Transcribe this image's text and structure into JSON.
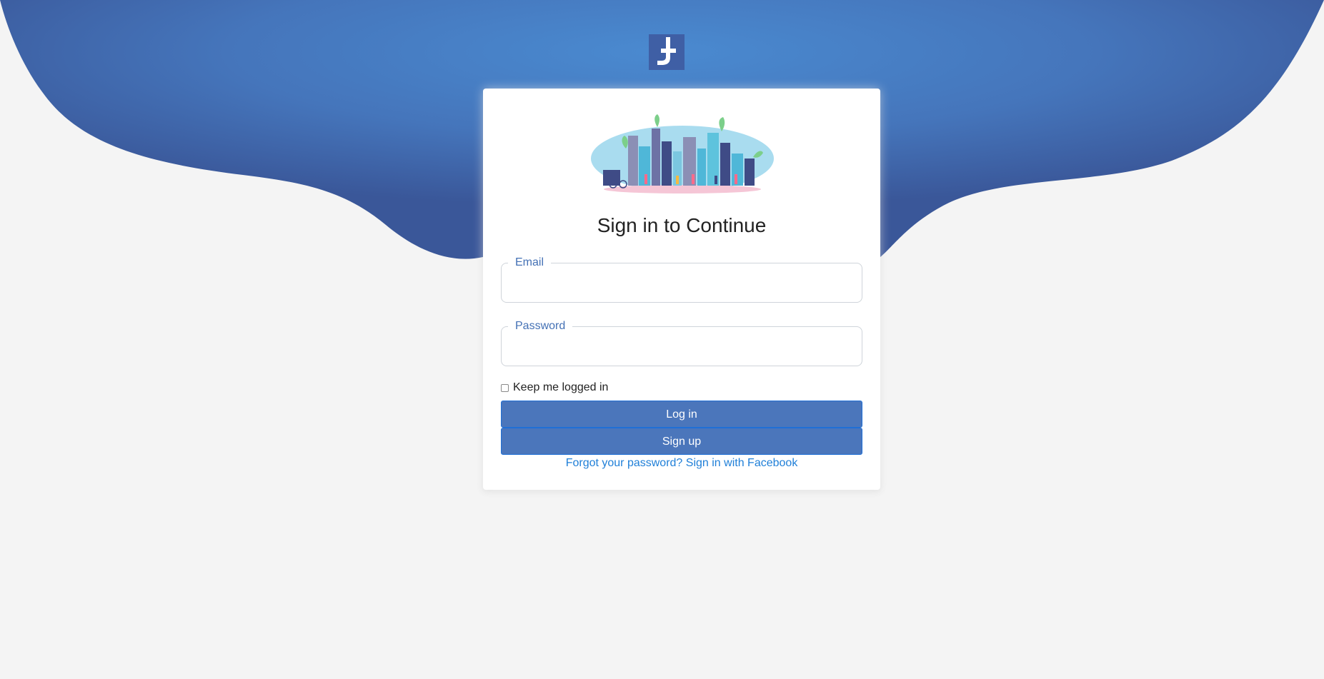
{
  "app": {
    "logo_icon": "facebook-like-f-icon",
    "colors": {
      "header_blue": "#3d5fa0",
      "header_blue_center": "#4a8ad0",
      "button_blue": "#4b76bb",
      "link_blue": "#1f7fd8",
      "legend_blue": "#4471b5",
      "page_bg": "#f4f4f4"
    }
  },
  "card": {
    "illustration": "city-illustration",
    "title": "Sign in to Continue",
    "email": {
      "label": "Email",
      "value": "",
      "placeholder": ""
    },
    "password": {
      "label": "Password",
      "value": "",
      "placeholder": ""
    },
    "remember": {
      "label": "Keep me logged in",
      "checked": false
    },
    "login_label": "Log in",
    "signup_label": "Sign up",
    "forgot_label": "Forgot your password?",
    "facebook_label": "Sign in with Facebook"
  }
}
